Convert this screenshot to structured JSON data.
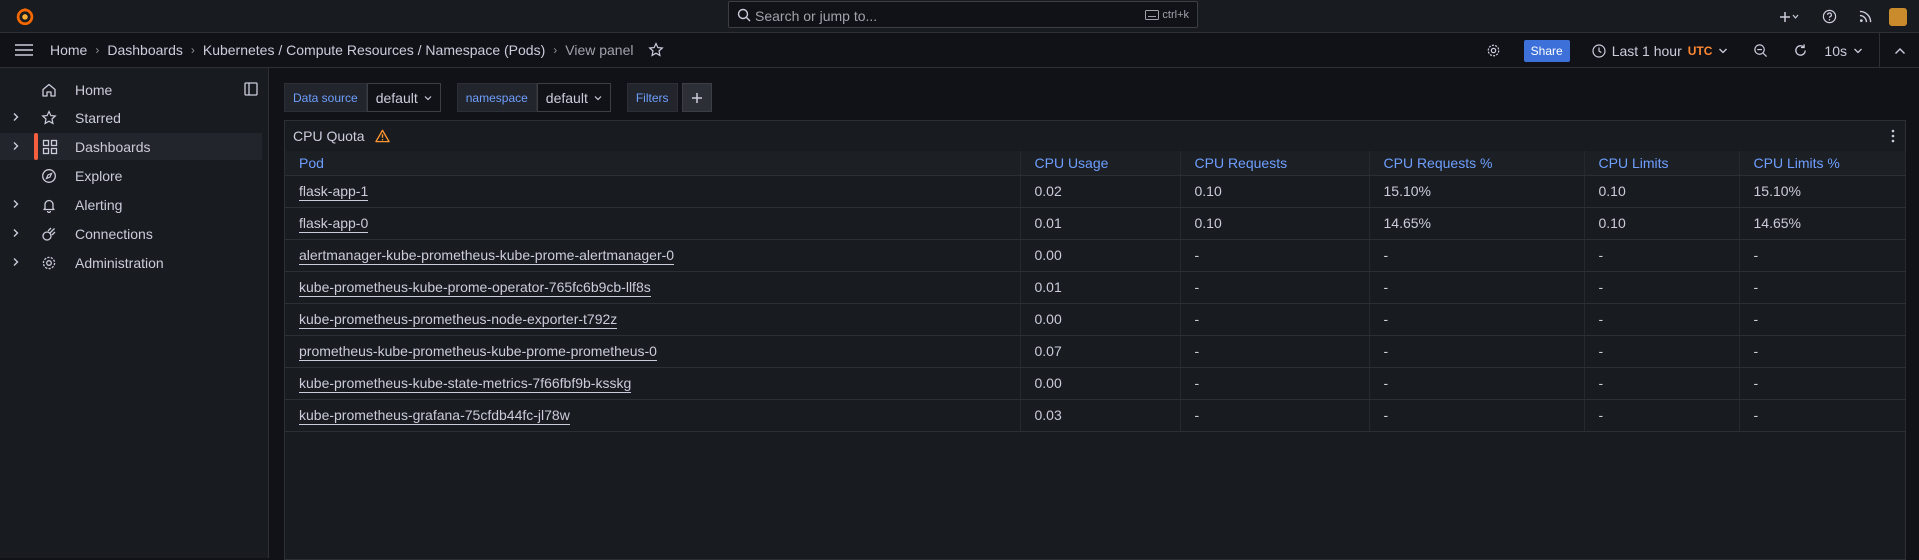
{
  "search": {
    "placeholder": "Search or jump to...",
    "shortcut": "ctrl+k"
  },
  "breadcrumb": [
    "Home",
    "Dashboards",
    "Kubernetes / Compute Resources / Namespace (Pods)",
    "View panel"
  ],
  "toolbar": {
    "share_label": "Share",
    "time_range": "Last 1 hour",
    "timezone": "UTC",
    "refresh_interval": "10s"
  },
  "sidebar": {
    "items": [
      {
        "label": "Home",
        "icon": "home-icon"
      },
      {
        "label": "Starred",
        "icon": "star-icon"
      },
      {
        "label": "Dashboards",
        "icon": "apps-icon"
      },
      {
        "label": "Explore",
        "icon": "compass-icon"
      },
      {
        "label": "Alerting",
        "icon": "bell-icon"
      },
      {
        "label": "Connections",
        "icon": "plug-icon"
      },
      {
        "label": "Administration",
        "icon": "cog-icon"
      }
    ]
  },
  "variables": {
    "datasource_label": "Data source",
    "datasource_value": "default",
    "namespace_label": "namespace",
    "namespace_value": "default",
    "filters_label": "Filters"
  },
  "panel": {
    "title": "CPU Quota",
    "columns": [
      "Pod",
      "CPU Usage",
      "CPU Requests",
      "CPU Requests %",
      "CPU Limits",
      "CPU Limits %"
    ],
    "rows": [
      [
        "flask-app-1",
        "0.02",
        "0.10",
        "15.10%",
        "0.10",
        "15.10%"
      ],
      [
        "flask-app-0",
        "0.01",
        "0.10",
        "14.65%",
        "0.10",
        "14.65%"
      ],
      [
        "alertmanager-kube-prometheus-kube-prome-alertmanager-0",
        "0.00",
        "-",
        "-",
        "-",
        "-"
      ],
      [
        "kube-prometheus-kube-prome-operator-765fc6b9cb-llf8s",
        "0.01",
        "-",
        "-",
        "-",
        "-"
      ],
      [
        "kube-prometheus-prometheus-node-exporter-t792z",
        "0.00",
        "-",
        "-",
        "-",
        "-"
      ],
      [
        "prometheus-kube-prometheus-kube-prome-prometheus-0",
        "0.07",
        "-",
        "-",
        "-",
        "-"
      ],
      [
        "kube-prometheus-kube-state-metrics-7f66fbf9b-ksskg",
        "0.00",
        "-",
        "-",
        "-",
        "-"
      ],
      [
        "kube-prometheus-grafana-75cfdb44fc-jl78w",
        "0.03",
        "-",
        "-",
        "-",
        "-"
      ]
    ]
  },
  "colors": {
    "accent": "#6e9fff",
    "brand": "#f55f3e",
    "share": "#3d71d9",
    "utc": "#ff8833",
    "warning": "#ff9830"
  }
}
